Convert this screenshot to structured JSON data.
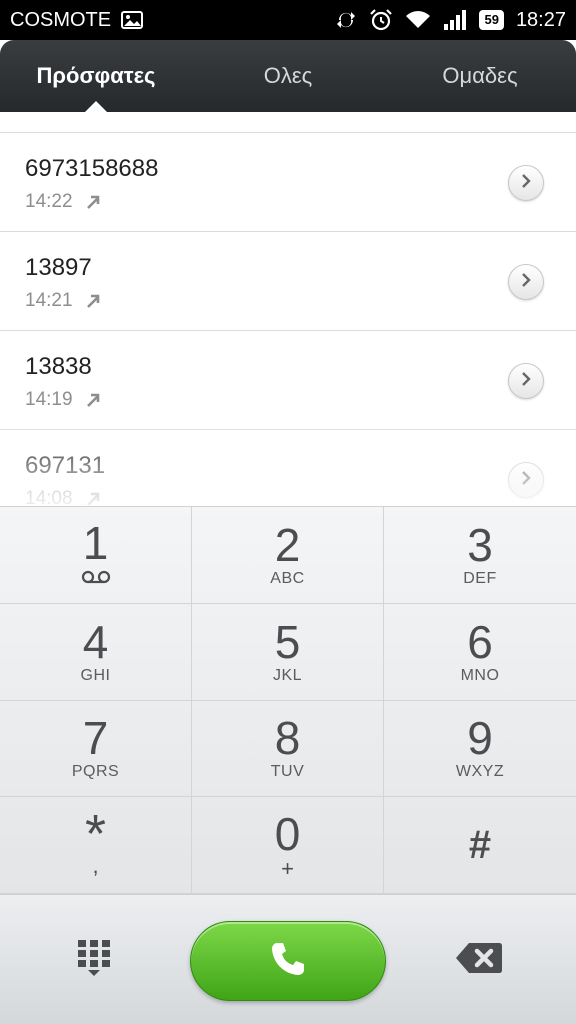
{
  "status_bar": {
    "carrier": "COSMOTE",
    "battery": "59",
    "time": "18:27"
  },
  "tabs": [
    {
      "label": "Πρόσφατες",
      "active": true
    },
    {
      "label": "Ολες",
      "active": false
    },
    {
      "label": "Ομαδες",
      "active": false
    }
  ],
  "calls": [
    {
      "number": "6973158688",
      "time": "14:22"
    },
    {
      "number": "13897",
      "time": "14:21"
    },
    {
      "number": "13838",
      "time": "14:19"
    },
    {
      "number": "697131",
      "time": "14:08"
    }
  ],
  "keypad": [
    {
      "digit": "1",
      "letters": ""
    },
    {
      "digit": "2",
      "letters": "ABC"
    },
    {
      "digit": "3",
      "letters": "DEF"
    },
    {
      "digit": "4",
      "letters": "GHI"
    },
    {
      "digit": "5",
      "letters": "JKL"
    },
    {
      "digit": "6",
      "letters": "MNO"
    },
    {
      "digit": "7",
      "letters": "PQRS"
    },
    {
      "digit": "8",
      "letters": "TUV"
    },
    {
      "digit": "9",
      "letters": "WXYZ"
    },
    {
      "digit": "*",
      "letters": ","
    },
    {
      "digit": "0",
      "letters": "+"
    },
    {
      "digit": "#",
      "letters": ""
    }
  ],
  "icons": {
    "gallery": "image-icon",
    "sync": "sync-icon",
    "alarm": "alarm-icon",
    "wifi": "wifi-icon",
    "signal": "signal-icon",
    "outgoing": "outgoing-call-icon",
    "detail": "chevron-right-icon",
    "voicemail": "voicemail-icon",
    "dialpad": "dialpad-icon",
    "call": "phone-icon",
    "backspace": "backspace-icon"
  },
  "colors": {
    "call_button": "#4cb51f",
    "tab_bar": "#2f3235"
  }
}
